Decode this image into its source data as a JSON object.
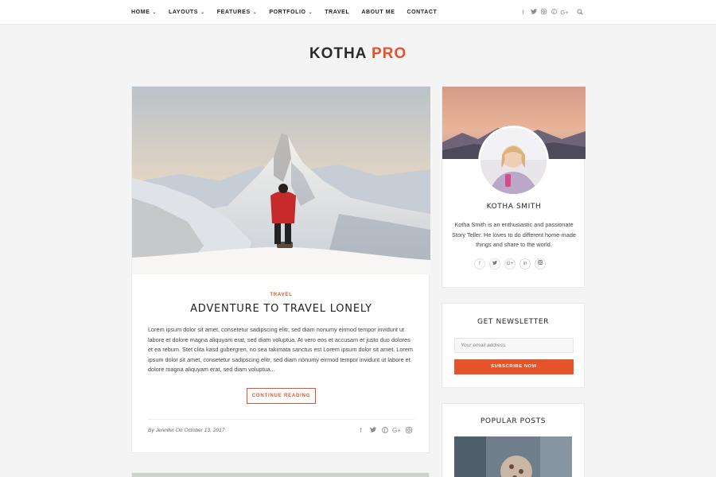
{
  "nav": {
    "items": [
      {
        "label": "HOME",
        "dropdown": true
      },
      {
        "label": "LAYOUTS",
        "dropdown": true
      },
      {
        "label": "FEATURES",
        "dropdown": true
      },
      {
        "label": "PORTFOLIO",
        "dropdown": true
      },
      {
        "label": "TRAVEL",
        "dropdown": false
      },
      {
        "label": "ABOUT ME",
        "dropdown": false
      },
      {
        "label": "CONTACT",
        "dropdown": false
      }
    ],
    "social_icons": [
      "facebook-icon",
      "twitter-icon",
      "instagram-icon",
      "pinterest-icon",
      "google-plus-icon",
      "search-icon"
    ]
  },
  "logo": {
    "part1": "KOTHA",
    "part2": "PRO"
  },
  "post": {
    "category": "TRAVEL",
    "title": "ADVENTURE TO TRAVEL LONELY",
    "excerpt": "Lorem ipsum dolor sit amet, consetetur sadipscing elitr, sed diam nonumy eirmod tempor invidunt ut labore et dolore magna aliquyam erat, sed diam voluptua. At vero eos et accusam et justo duo dolores et ea rebum. Stet clita kasd gubergren, no sea takimata sanctus est Lorem ipsum dolor sit amet. Lorem ipsum dolor sit amet, consetetur sadipscing elitr, sed diam nonumy eirmod tempor invidunt ut labore et dolore magna aliquyam erat, sed diam voluptua...",
    "read_more": "CONTINUE READING",
    "meta": "By Jennifer On October 13, 2017",
    "share_icons": [
      "facebook-icon",
      "twitter-icon",
      "pinterest-icon",
      "google-plus-icon",
      "instagram-icon"
    ]
  },
  "about": {
    "name": "KOTHA SMITH",
    "text": "Kotha Smith is an enthusiastic and passionate Story Teller. He loves to do different home-made things and share to the world.",
    "social_icons": [
      "facebook-icon",
      "twitter-icon",
      "google-plus-icon",
      "linkedin-icon",
      "instagram-icon"
    ]
  },
  "newsletter": {
    "title": "GET NEWSLETTER",
    "email_placeholder": "Your email address",
    "button": "SUBSCRIBE NOW"
  },
  "popular": {
    "title": "POPULAR POSTS"
  },
  "colors": {
    "accent": "#e5532a",
    "background": "#f4f4f4",
    "card": "#ffffff"
  }
}
